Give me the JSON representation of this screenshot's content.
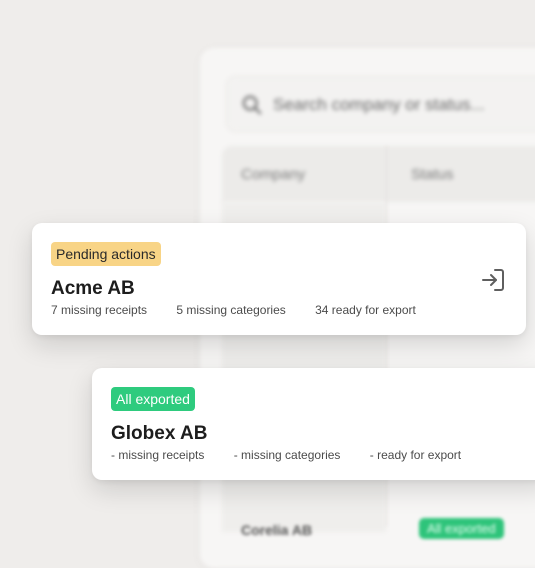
{
  "background": {
    "search_placeholder": "Search company or status...",
    "table_headers": [
      "Company",
      "Status"
    ],
    "row": {
      "company": "Corelia AB",
      "status": "All exported"
    }
  },
  "cards": [
    {
      "status_label": "Pending actions",
      "status_color": "#f8d486",
      "company": "Acme AB",
      "missing_receipts": "7 missing receipts",
      "missing_categories": "5 missing categories",
      "ready_for_export": "34 ready for export",
      "action_icon": "login-arrow-icon"
    },
    {
      "status_label": "All exported",
      "status_color": "#2ecb7e",
      "company": "Globex AB",
      "missing_receipts": "- missing receipts",
      "missing_categories": "- missing categories",
      "ready_for_export": "- ready for export"
    }
  ]
}
